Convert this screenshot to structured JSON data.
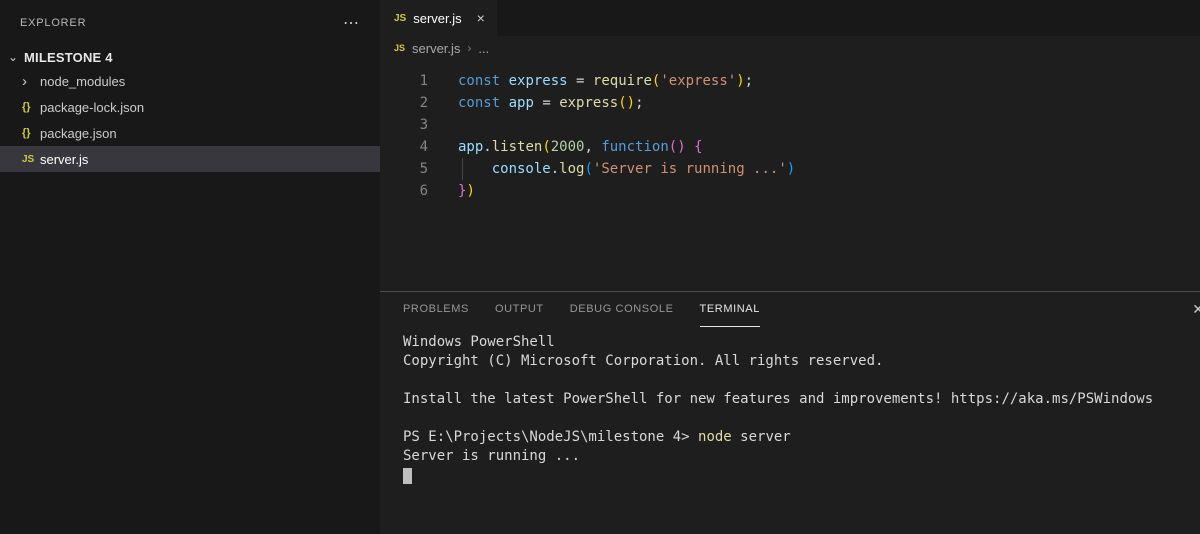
{
  "palette": {
    "keyword": "#569cd6",
    "variable": "#9cdcfe",
    "function": "#dcdcaa",
    "string": "#ce9178",
    "number": "#b5cea8",
    "bracket1": "#ffd700",
    "bracket2": "#da70d6",
    "bracket3": "#179fff",
    "default_code": "#d4d4d4",
    "terminal_fg": "#d8d8d8",
    "terminal_command": "#dcdcaa",
    "selection_bg": "#37373d",
    "js_icon": "#cbcb41"
  },
  "sidebar": {
    "header": "EXPLORER",
    "more_glyph": "⋯",
    "section_chevron": "⌄",
    "section": "MILESTONE 4",
    "items": [
      {
        "icon": "chevron-right",
        "glyph": "›",
        "label": "node_modules",
        "selected": false
      },
      {
        "icon": "json",
        "glyph": "{}",
        "label": "package-lock.json",
        "selected": false
      },
      {
        "icon": "json",
        "glyph": "{}",
        "label": "package.json",
        "selected": false
      },
      {
        "icon": "js",
        "glyph": "JS",
        "label": "server.js",
        "selected": true
      }
    ]
  },
  "editor": {
    "tab": {
      "icon": "JS",
      "label": "server.js",
      "close": "×"
    },
    "breadcrumb": {
      "icon": "JS",
      "file": "server.js",
      "separator": "›",
      "more": "..."
    },
    "code": {
      "lines": [
        {
          "tokens": [
            {
              "t": "const",
              "c": "kw"
            },
            {
              "t": " "
            },
            {
              "t": "express",
              "c": "var"
            },
            {
              "t": " = "
            },
            {
              "t": "require",
              "c": "fn"
            },
            {
              "t": "(",
              "c": "b1"
            },
            {
              "t": "'express'",
              "c": "str"
            },
            {
              "t": ")",
              "c": "b1"
            },
            {
              "t": ";"
            }
          ]
        },
        {
          "tokens": [
            {
              "t": "const",
              "c": "kw"
            },
            {
              "t": " "
            },
            {
              "t": "app",
              "c": "var"
            },
            {
              "t": " = "
            },
            {
              "t": "express",
              "c": "fn"
            },
            {
              "t": "(",
              "c": "b1"
            },
            {
              "t": ")",
              "c": "b1"
            },
            {
              "t": ";"
            }
          ]
        },
        {
          "tokens": []
        },
        {
          "tokens": [
            {
              "t": "app",
              "c": "var"
            },
            {
              "t": "."
            },
            {
              "t": "listen",
              "c": "fn"
            },
            {
              "t": "(",
              "c": "b1"
            },
            {
              "t": "2000",
              "c": "num"
            },
            {
              "t": ", "
            },
            {
              "t": "function",
              "c": "kw"
            },
            {
              "t": "(",
              "c": "b2"
            },
            {
              "t": ")",
              "c": "b2"
            },
            {
              "t": " "
            },
            {
              "t": "{",
              "c": "b2"
            }
          ]
        },
        {
          "tokens": [
            {
              "t": "    "
            },
            {
              "t": "console",
              "c": "var"
            },
            {
              "t": "."
            },
            {
              "t": "log",
              "c": "fn"
            },
            {
              "t": "(",
              "c": "b3"
            },
            {
              "t": "'Server is running ...'",
              "c": "str"
            },
            {
              "t": ")",
              "c": "b3"
            }
          ]
        },
        {
          "tokens": [
            {
              "t": "}",
              "c": "b2"
            },
            {
              "t": ")",
              "c": "b1"
            }
          ]
        }
      ]
    }
  },
  "panel": {
    "tabs": [
      "PROBLEMS",
      "OUTPUT",
      "DEBUG CONSOLE",
      "TERMINAL"
    ],
    "active_tab": "TERMINAL",
    "close_glyph": "✕",
    "terminal_lines": [
      {
        "tokens": [
          {
            "t": "Windows PowerShell"
          }
        ]
      },
      {
        "tokens": [
          {
            "t": "Copyright (C) Microsoft Corporation. All rights reserved."
          }
        ]
      },
      {
        "tokens": []
      },
      {
        "tokens": [
          {
            "t": "Install the latest PowerShell for new features and improvements! https://aka.ms/PSWindows"
          }
        ]
      },
      {
        "tokens": []
      },
      {
        "tokens": [
          {
            "t": "PS E:\\Projects\\NodeJS\\milestone 4> "
          },
          {
            "t": "node",
            "c": "cmd"
          },
          {
            "t": " server"
          }
        ]
      },
      {
        "tokens": [
          {
            "t": "Server is running ..."
          }
        ]
      }
    ],
    "cursor_visible": true
  }
}
